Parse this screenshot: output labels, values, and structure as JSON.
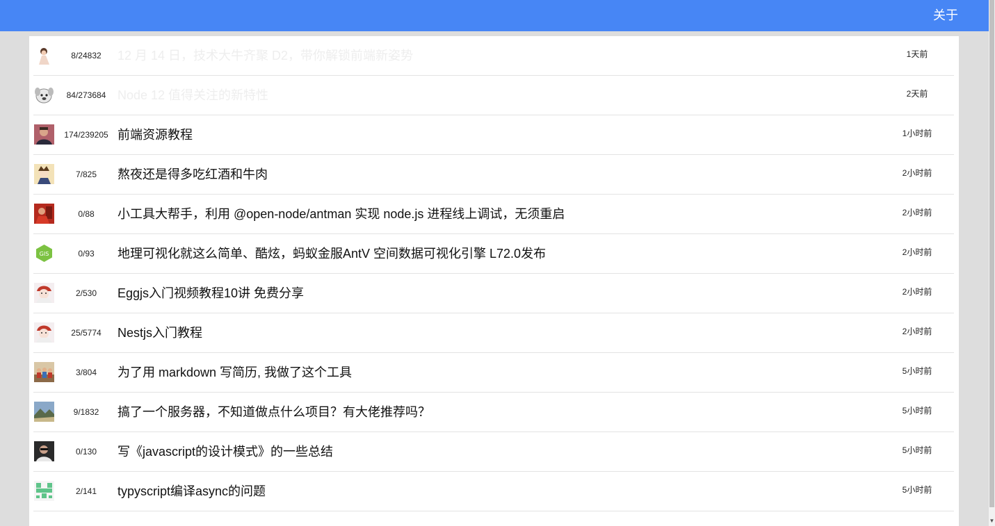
{
  "header": {
    "about_label": "关于",
    "bar_color": "#4786f5"
  },
  "topics": [
    {
      "avatar_icon": "woman-avatar",
      "counts": "8/24832",
      "title": "12 月 14 日，技术大牛齐聚 D2，带你解锁前端新姿势",
      "time": "1天前",
      "faded": true
    },
    {
      "avatar_icon": "cartoon-dog-avatar",
      "counts": "84/273684",
      "title": "Node 12 值得关注的新特性",
      "time": "2天前",
      "faded": true
    },
    {
      "avatar_icon": "man-portrait-avatar",
      "counts": "174/239205",
      "title": "前端资源教程",
      "time": "1小时前",
      "faded": false
    },
    {
      "avatar_icon": "anime-avatar",
      "counts": "7/825",
      "title": "熬夜还是得多吃红酒和牛肉",
      "time": "2小时前",
      "faded": false
    },
    {
      "avatar_icon": "red-photo-avatar",
      "counts": "0/88",
      "title": "小工具大帮手，利用 @open-node/antman 实现 node.js 进程线上调试，无须重启",
      "time": "2小时前",
      "faded": false
    },
    {
      "avatar_icon": "gis-hexagon-avatar",
      "counts": "0/93",
      "title": "地理可视化就这么简单、酷炫，蚂蚁金服AntV 空间数据可视化引擎 L72.0发布",
      "time": "2小时前",
      "faded": false
    },
    {
      "avatar_icon": "girl-hat-avatar",
      "counts": "2/530",
      "title": "Eggjs入门视频教程10讲 免费分享",
      "time": "2小时前",
      "faded": false
    },
    {
      "avatar_icon": "girl-hat-avatar",
      "counts": "25/5774",
      "title": "Nestjs入门教程",
      "time": "2小时前",
      "faded": false
    },
    {
      "avatar_icon": "group-photo-avatar",
      "counts": "3/804",
      "title": "为了用 markdown 写简历, 我做了这个工具",
      "time": "5小时前",
      "faded": false
    },
    {
      "avatar_icon": "landscape-avatar",
      "counts": "9/1832",
      "title": "搞了一个服务器，不知道做点什么项目？有大佬推荐吗？",
      "time": "5小时前",
      "faded": false
    },
    {
      "avatar_icon": "dark-portrait-avatar",
      "counts": "0/130",
      "title": "写《javascript的设计模式》的一些总结",
      "time": "5小时前",
      "faded": false
    },
    {
      "avatar_icon": "green-identicon-avatar",
      "counts": "2/141",
      "title": "typyscript编译async的问题",
      "time": "5小时前",
      "faded": false
    }
  ]
}
